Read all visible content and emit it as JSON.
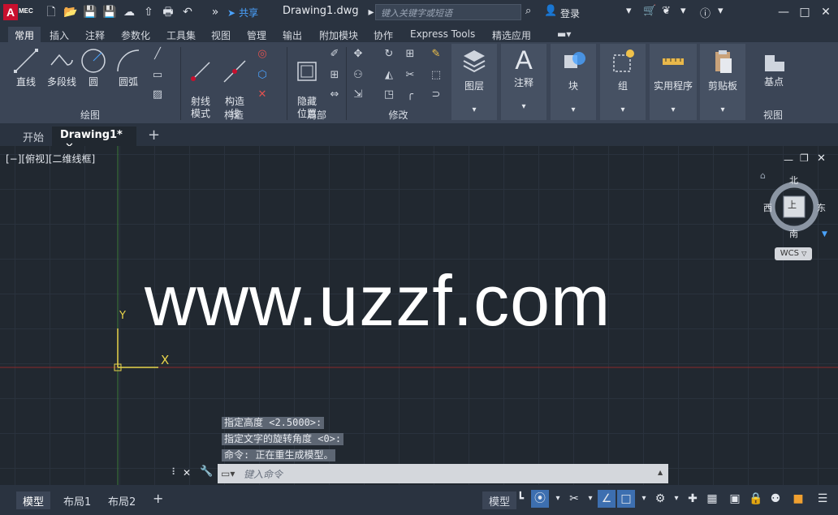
{
  "app": {
    "logo_letter": "A",
    "logo_badge": "MEC",
    "document_title": "Drawing1.dwg"
  },
  "titlebar": {
    "share_label": "共享",
    "search_placeholder": "键入关键字或短语",
    "login_label": "登录"
  },
  "ribbon_tabs": [
    "常用",
    "插入",
    "注释",
    "参数化",
    "工具集",
    "视图",
    "管理",
    "输出",
    "附加模块",
    "协作",
    "Express Tools",
    "精选应用"
  ],
  "ribbon_active_tab": "常用",
  "draw_panel": {
    "title": "绘图",
    "tools": [
      "直线",
      "多段线",
      "圆",
      "圆弧"
    ]
  },
  "construct_panel": {
    "title": "构造",
    "tools": [
      "射线\n模式",
      "构造\n线"
    ]
  },
  "section_panel": {
    "title": "局部",
    "tools": [
      "隐藏\n位置"
    ]
  },
  "modify_panel": {
    "title": "修改"
  },
  "big_panels": [
    "图层",
    "注释",
    "块",
    "组",
    "实用程序",
    "剪贴板",
    "基点"
  ],
  "view_panel": {
    "title": "视图"
  },
  "file_tabs": {
    "start": "开始",
    "drawing": "Drawing1*"
  },
  "viewport": {
    "view_label": "[−][俯视][二维线框]",
    "watermark": "www.uzzf.com",
    "compass": {
      "north": "北",
      "south": "南",
      "east": "东",
      "west": "西",
      "center": "上"
    },
    "wcs_label": "WCS",
    "axis_y": "Y",
    "axis_x": "X"
  },
  "command_history": [
    "指定高度 <2.5000>:",
    "指定文字的旋转角度 <0>:",
    "命令: 正在重生成模型。"
  ],
  "command_input_placeholder": "键入命令",
  "layout_tabs": [
    "模型",
    "布局1",
    "布局2"
  ],
  "layout_active": "模型",
  "status_model_label": "模型",
  "colors": {
    "accent": "#3d6fb0",
    "brand": "#c8102e",
    "share": "#4aa3ff"
  }
}
